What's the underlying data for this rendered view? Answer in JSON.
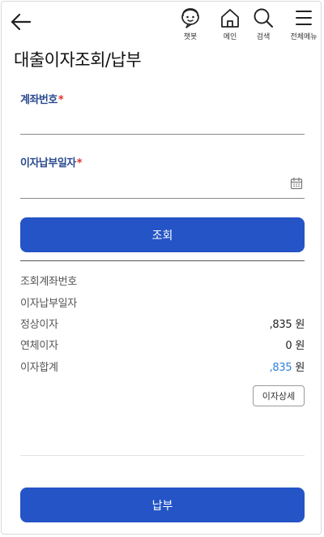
{
  "header": {
    "nav": [
      {
        "label": "챗봇",
        "icon": "chatbot-icon"
      },
      {
        "label": "메인",
        "icon": "home-icon"
      },
      {
        "label": "검색",
        "icon": "search-icon"
      },
      {
        "label": "전체메뉴",
        "icon": "menu-icon"
      }
    ],
    "title": "대출이자조회/납부"
  },
  "form": {
    "account": {
      "label": "계좌번호",
      "required_mark": "*",
      "value": "",
      "placeholder": ""
    },
    "date": {
      "label": "이자납부일자",
      "required_mark": "*",
      "value": "",
      "placeholder": ""
    },
    "inquiry_button": "조회"
  },
  "result": {
    "rows": [
      {
        "label": "조회계좌번호",
        "value": ""
      },
      {
        "label": "이자납부일자",
        "value": ""
      },
      {
        "label": "정상이자",
        "value": ",835",
        "unit": "원"
      },
      {
        "label": "연체이자",
        "value": "0",
        "unit": "원"
      },
      {
        "label": "이자합계",
        "value": ",835",
        "unit": "원"
      }
    ],
    "detail_button": "이자상세"
  },
  "pay_button": "납부",
  "colors": {
    "primary": "#2454c6",
    "label_blue": "#2a4a8f",
    "required": "#e0302f",
    "total_blue": "#2f7fd9"
  }
}
